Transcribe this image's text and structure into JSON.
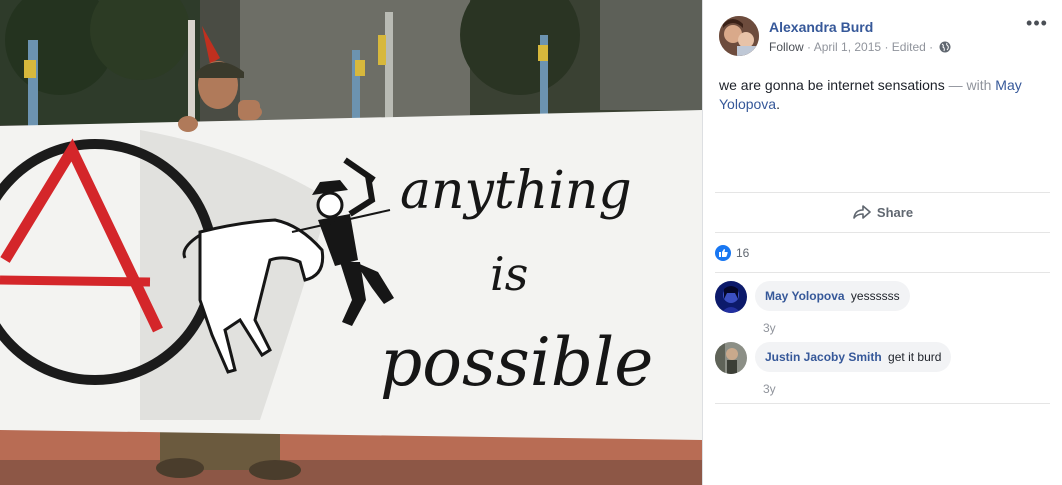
{
  "post": {
    "author": "Alexandra Burd",
    "follow_label": "Follow",
    "date": "April 1, 2015",
    "edited_label": "Edited",
    "separator": "·",
    "text": "we are gonna be internet sensations",
    "with_label": "— with",
    "tagged": "May Yolopova",
    "tagged_suffix": "."
  },
  "actions": {
    "share_label": "Share"
  },
  "reactions": {
    "count": "16"
  },
  "comments": [
    {
      "author": "May Yolopova",
      "text": "yessssss",
      "time": "3y"
    },
    {
      "author": "Justin Jacoby Smith",
      "text": "get it burd",
      "time": "3y"
    }
  ],
  "photo": {
    "banner_line1": "anything",
    "banner_line2": "is",
    "banner_line3": "possible"
  },
  "icons": {
    "globe": "globe-icon",
    "more": "more-options-icon",
    "share": "share-icon",
    "like": "like-icon"
  },
  "colors": {
    "link": "#365899",
    "meta": "#90949c",
    "like_blue": "#1877f2",
    "bubble": "#f2f3f5"
  }
}
